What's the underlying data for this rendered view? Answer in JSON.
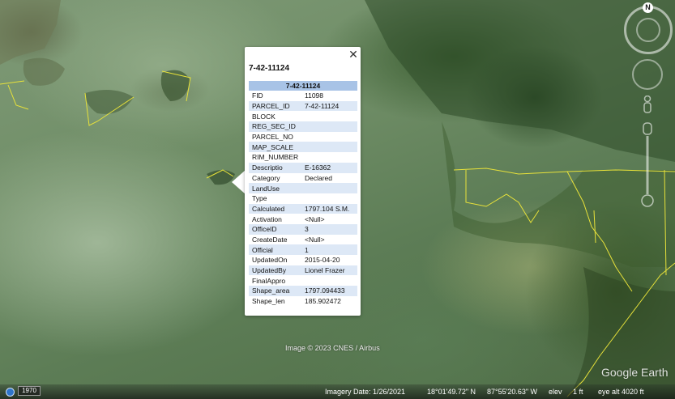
{
  "popup": {
    "title": "7-42-11124",
    "close_icon": "close-icon",
    "table_header": "7-42-11124",
    "rows": [
      {
        "key": "FID",
        "value": "11098"
      },
      {
        "key": "PARCEL_ID",
        "value": "7-42-11124"
      },
      {
        "key": "BLOCK",
        "value": ""
      },
      {
        "key": "REG_SEC_ID",
        "value": ""
      },
      {
        "key": "PARCEL_NO",
        "value": ""
      },
      {
        "key": "MAP_SCALE",
        "value": ""
      },
      {
        "key": "RIM_NUMBER",
        "value": ""
      },
      {
        "key": "Descriptio",
        "value": "E-16362"
      },
      {
        "key": "Category",
        "value": "Declared"
      },
      {
        "key": "LandUse",
        "value": ""
      },
      {
        "key": "Type",
        "value": ""
      },
      {
        "key": "Calculated",
        "value": "1797.104 S.M."
      },
      {
        "key": "Activation",
        "value": "<Null>"
      },
      {
        "key": "OfficeID",
        "value": "3"
      },
      {
        "key": "CreateDate",
        "value": "<Null>"
      },
      {
        "key": "Official",
        "value": "1"
      },
      {
        "key": "UpdatedOn",
        "value": "2015-04-20"
      },
      {
        "key": "UpdatedBy",
        "value": "Lionel Frazer"
      },
      {
        "key": "FinalAppro",
        "value": ""
      },
      {
        "key": "Shape_area",
        "value": "1797.094433"
      },
      {
        "key": "Shape_len",
        "value": "185.902472"
      }
    ]
  },
  "map": {
    "copyright": "Image © 2023 CNES / Airbus",
    "logo": "Google Earth",
    "north_label": "N"
  },
  "status_bar": {
    "historical_year": "1970",
    "imagery_date": "Imagery Date: 1/26/2021",
    "latitude": "18°01'49.72\" N",
    "longitude": "87°55'20.63\" W",
    "elev_label": "elev",
    "elev_value": "1 ft",
    "eye_alt": "eye alt   4020 ft"
  },
  "colors": {
    "table_header_bg": "#a8c3e6",
    "table_alt_row_bg": "#dde8f6",
    "parcel_boundary": "#e8e23a"
  },
  "icons": [
    "compass-icon",
    "look-joystick-icon",
    "street-view-pegman-icon",
    "zoom-slider-icon",
    "globe-icon",
    "close-icon"
  ]
}
